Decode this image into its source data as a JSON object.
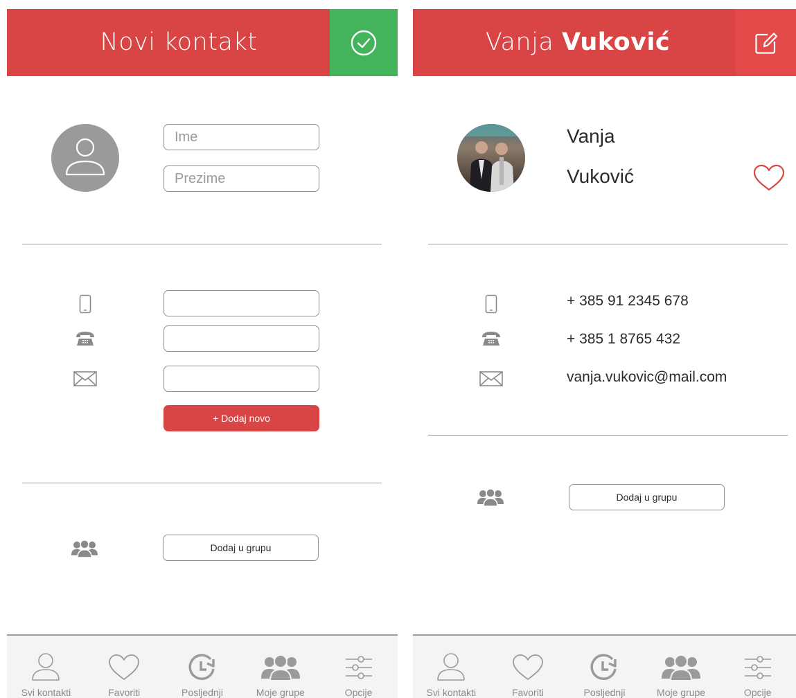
{
  "colors": {
    "accent": "#d94545",
    "confirm": "#44b45c",
    "edit": "#e34a4a",
    "icon_gray": "#9a9a9d"
  },
  "new_contact": {
    "title": "Novi kontakt",
    "confirm_icon": "check-circle-icon",
    "first_name": {
      "placeholder": "Ime",
      "value": ""
    },
    "last_name": {
      "placeholder": "Prezime",
      "value": ""
    },
    "mobile": {
      "icon": "mobile-phone-icon",
      "value": ""
    },
    "phone": {
      "icon": "telephone-icon",
      "value": ""
    },
    "email": {
      "icon": "envelope-icon",
      "value": ""
    },
    "add_new_label": "+ Dodaj novo",
    "group_icon": "group-icon",
    "add_to_group_label": "Dodaj u grupu"
  },
  "contact_detail": {
    "title_first": "Vanja",
    "title_last": "Vuković",
    "edit_icon": "edit-icon",
    "first_name": "Vanja",
    "last_name": "Vuković",
    "favorite_icon": "heart-icon",
    "mobile": "+ 385 91 2345 678",
    "phone": "+ 385 1 8765 432",
    "email": "vanja.vukovic@mail.com",
    "add_to_group_label": "Dodaj u grupu"
  },
  "tabbar": [
    {
      "icon": "person-icon",
      "label": "Svi kontakti"
    },
    {
      "icon": "heart-icon",
      "label": "Favoriti"
    },
    {
      "icon": "recent-clock-icon",
      "label": "Posljednji"
    },
    {
      "icon": "group-icon",
      "label": "Moje grupe"
    },
    {
      "icon": "sliders-icon",
      "label": "Opcije"
    }
  ]
}
